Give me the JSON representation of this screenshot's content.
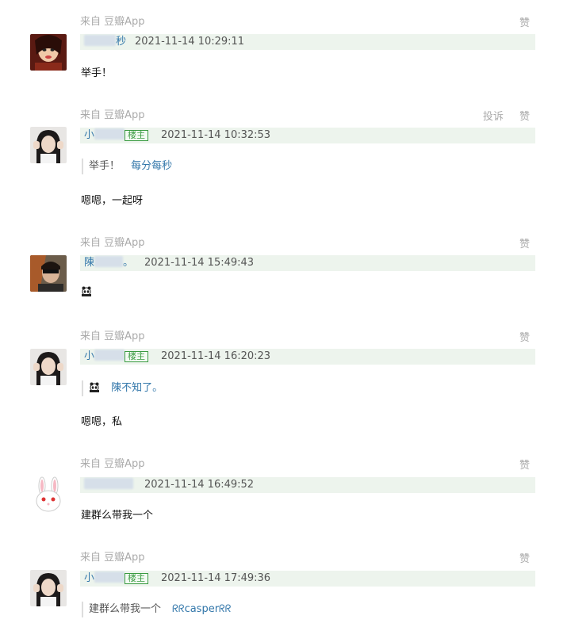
{
  "comments": [
    {
      "source": "来自 豆瓣App",
      "actions": [
        "赞"
      ],
      "user": {
        "prefix": "",
        "suffix": "秒"
      },
      "time": "2021-11-14 10:29:11",
      "content": "举手！"
    },
    {
      "source": "来自 豆瓣App",
      "actions": [
        "投诉",
        "赞"
      ],
      "user": {
        "prefix": "小",
        "suffix": "",
        "badge": "楼主"
      },
      "time": "2021-11-14 10:32:53",
      "quote": {
        "text": "举手！",
        "author": "每分每秒"
      },
      "content": "嗯嗯，一起呀"
    },
    {
      "source": "来自 豆瓣App",
      "actions": [
        "赞"
      ],
      "user": {
        "prefix": "陳",
        "suffix": "。"
      },
      "time": "2021-11-14 15:49:43",
      "content_icon": "panda-emoji-icon"
    },
    {
      "source": "来自 豆瓣App",
      "actions": [
        "赞"
      ],
      "user": {
        "prefix": "小",
        "suffix": "",
        "badge": "楼主"
      },
      "time": "2021-11-14 16:20:23",
      "quote": {
        "text_icon": "panda-emoji-icon",
        "author": "陳不知了。"
      },
      "content": "嗯嗯，私"
    },
    {
      "source": "来自 豆瓣App",
      "actions": [
        "赞"
      ],
      "user": {
        "prefix": "",
        "suffix": ""
      },
      "time": "2021-11-14 16:49:52",
      "content": "建群么带我一个"
    },
    {
      "source": "来自 豆瓣App",
      "actions": [
        "赞"
      ],
      "user": {
        "prefix": "小",
        "suffix": "",
        "badge": "楼主"
      },
      "time": "2021-11-14 17:49:36",
      "quote": {
        "text": "建群么带我一个",
        "author": "casper"
      }
    }
  ],
  "colors": {
    "link": "#3377aa",
    "meta_bg": "#edf4ed",
    "muted": "#aaaaaa",
    "badge": "#3a9b41"
  }
}
